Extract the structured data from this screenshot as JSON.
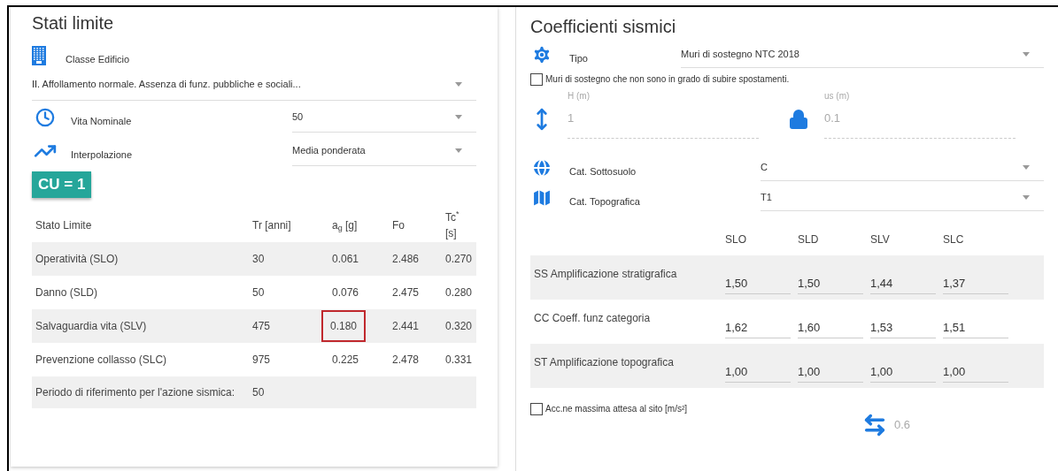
{
  "left_panel": {
    "title": "Stati limite",
    "classe": {
      "label": "Classe Edificio",
      "value": "II. Affollamento normale. Assenza di funz. pubbliche e sociali..."
    },
    "fields": [
      {
        "kind": "clock",
        "label": "Vita Nominale",
        "value": "50"
      },
      {
        "kind": "chart",
        "label": "Interpolazione",
        "value": "Media ponderata"
      }
    ],
    "badge": "CU = 1",
    "table": {
      "columns": [
        "Stato Limite",
        "Tr [anni]",
        "a$_{g}$ [g]",
        "Fo",
        "Tc$^{*}$ [s]"
      ],
      "rows": [
        {
          "cells": [
            "Operatività (SLO)",
            "30",
            "0.061",
            "2.486",
            "0.270"
          ],
          "highlighted": [
            false,
            false,
            false,
            false,
            false
          ]
        },
        {
          "cells": [
            "Danno (SLD)",
            "50",
            "0.076",
            "2.475",
            "0.280"
          ],
          "highlighted": [
            false,
            false,
            false,
            false,
            false
          ]
        },
        {
          "cells": [
            "Salvaguardia vita (SLV)",
            "475",
            "0.180",
            "2.441",
            "0.320"
          ],
          "highlighted": [
            false,
            false,
            true,
            false,
            false
          ]
        },
        {
          "cells": [
            "Prevenzione collasso (SLC)",
            "975",
            "0.225",
            "2.478",
            "0.331"
          ],
          "highlighted": [
            false,
            false,
            false,
            false,
            false
          ]
        },
        {
          "cells": [
            "Periodo di riferimento per l'azione sismica:",
            "50"
          ],
          "highlighted": [
            false,
            false
          ]
        }
      ]
    }
  },
  "right_panel": {
    "title": "Coefficienti sismici",
    "tipo": {
      "label": "Tipo",
      "value": "Muri di sostegno NTC 2018"
    },
    "checkbox_muri": {
      "label": "Muri di sostegno che non sono in grado di subire spostamenti.",
      "checked": false
    },
    "inputs": [
      {
        "kind": "height",
        "label": "H (m)",
        "value": "1",
        "disabled": true
      },
      {
        "kind": "lock",
        "label": "us (m)",
        "value": "0.1",
        "disabled": true
      }
    ],
    "selects": [
      {
        "kind": "globe",
        "label": "Cat. Sottosuolo",
        "value": "C"
      },
      {
        "kind": "map",
        "label": "Cat. Topografica",
        "value": "T1"
      }
    ],
    "table": {
      "columns": [
        "SLO",
        "SLD",
        "SLV",
        "SLC"
      ],
      "rows": [
        {
          "label": "SS Amplificazione stratigrafica",
          "values": [
            "1,50",
            "1,50",
            "1,44",
            "1,37"
          ]
        },
        {
          "label": "CC Coeff. funz categoria",
          "values": [
            "1,62",
            "1,60",
            "1,53",
            "1,51"
          ]
        },
        {
          "label": "ST Amplificazione topografica",
          "values": [
            "1,00",
            "1,00",
            "1,00",
            "1,00"
          ]
        }
      ]
    },
    "checkbox_acc": {
      "label": "Acc.ne massima attesa al sito [m/s²]",
      "checked": false
    },
    "acc_value": {
      "value": "0.6",
      "disabled": true
    }
  }
}
